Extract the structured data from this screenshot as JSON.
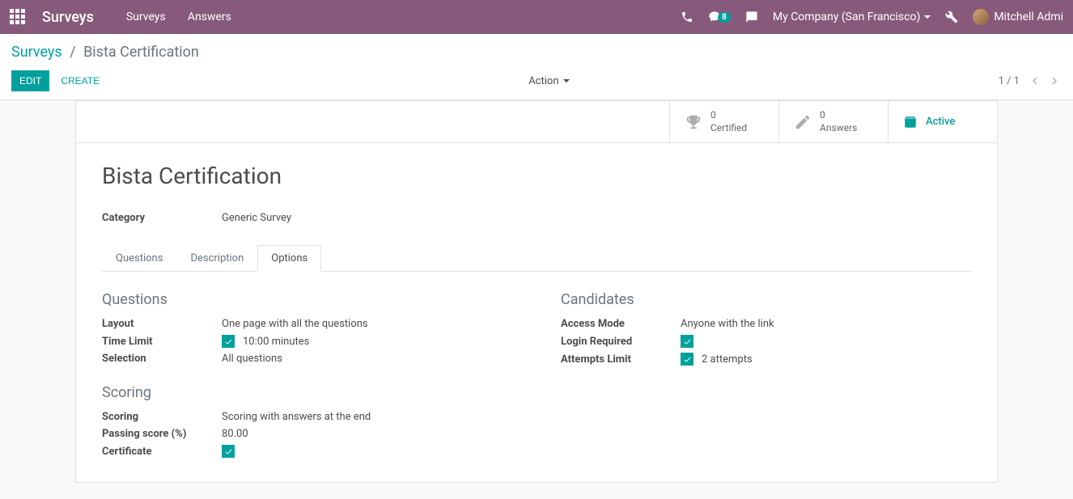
{
  "topbar": {
    "brand": "Surveys",
    "nav": {
      "surveys": "Surveys",
      "answers": "Answers"
    },
    "messaging_count": "8",
    "company": "My Company (San Francisco)",
    "user": "Mitchell Admi"
  },
  "breadcrumb": {
    "parent": "Surveys",
    "current": "Bista Certification"
  },
  "toolbar": {
    "edit": "EDIT",
    "create": "CREATE",
    "action": "Action"
  },
  "pager": {
    "position": "1 / 1"
  },
  "stat_buttons": {
    "certified": {
      "count": "0",
      "label": "Certified"
    },
    "answers": {
      "count": "0",
      "label": "Answers"
    },
    "active": "Active"
  },
  "record": {
    "title": "Bista Certification",
    "category_label": "Category",
    "category_value": "Generic Survey"
  },
  "tabs": {
    "questions": "Questions",
    "description": "Description",
    "options": "Options"
  },
  "options": {
    "questions_section": "Questions",
    "layout_label": "Layout",
    "layout_value": "One page with all the questions",
    "timelimit_label": "Time Limit",
    "timelimit_value": "10:00 minutes",
    "selection_label": "Selection",
    "selection_value": "All questions",
    "scoring_section": "Scoring",
    "scoring_label": "Scoring",
    "scoring_value": "Scoring with answers at the end",
    "passing_label": "Passing score (%)",
    "passing_value": "80.00",
    "certificate_label": "Certificate",
    "candidates_section": "Candidates",
    "access_mode_label": "Access Mode",
    "access_mode_value": "Anyone with the link",
    "login_label": "Login Required",
    "attempts_label": "Attempts Limit",
    "attempts_value": "2 attempts"
  }
}
